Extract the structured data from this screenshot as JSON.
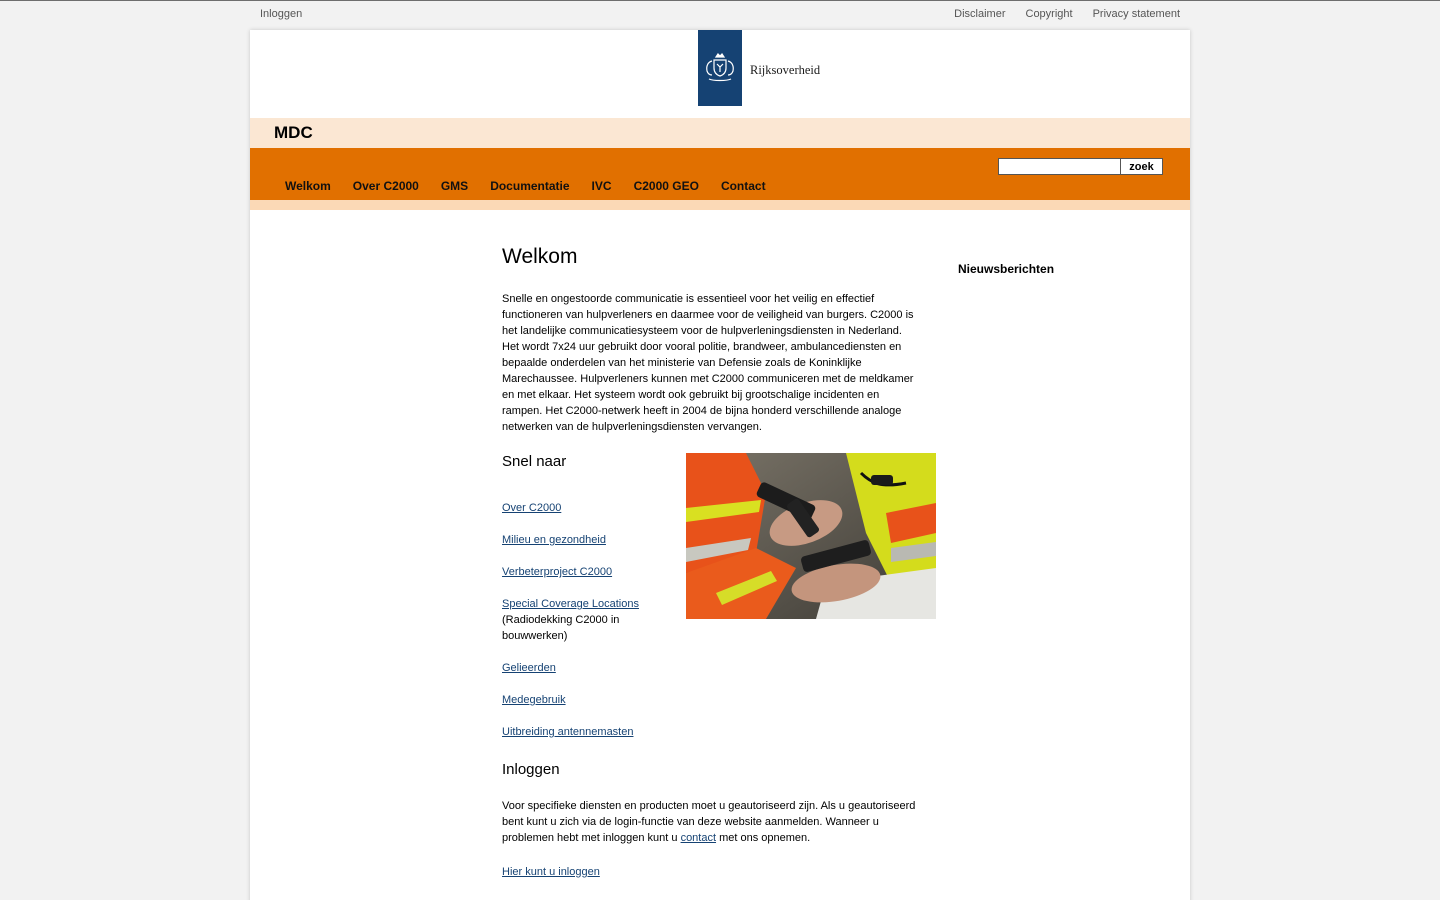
{
  "topbar": {
    "login": "Inloggen",
    "links": [
      "Disclaimer",
      "Copyright",
      "Privacy statement"
    ]
  },
  "logo": {
    "text": "Rijksoverheid"
  },
  "site": {
    "title": "MDC"
  },
  "search": {
    "button": "zoek",
    "value": ""
  },
  "nav": [
    "Welkom",
    "Over C2000",
    "GMS",
    "Documentatie",
    "IVC",
    "C2000 GEO",
    "Contact"
  ],
  "main": {
    "title": "Welkom",
    "intro": "Snelle en ongestoorde communicatie is essentieel voor het veilig en effectief functioneren van hulpverleners en daarmee voor de veiligheid van burgers. C2000 is het landelijke communicatiesysteem voor de hulpverleningsdiensten in Nederland. Het wordt 7x24 uur gebruikt door vooral politie, brandweer, ambulancediensten en bepaalde onderdelen van het ministerie van Defensie zoals de Koninklijke Marechaussee. Hulpverleners kunnen met C2000 communiceren met de meldkamer en met elkaar. Het systeem wordt ook gebruikt bij grootschalige incidenten en rampen. Het C2000-netwerk heeft in 2004 de bijna honderd verschillende analoge netwerken van de hulpverleningsdiensten vervangen.",
    "quick_title": "Snel naar",
    "quick_links": [
      {
        "label": "Over C2000",
        "note": ""
      },
      {
        "label": "Milieu en gezondheid",
        "note": ""
      },
      {
        "label": "Verbeterproject C2000",
        "note": ""
      },
      {
        "label": "Special Coverage Locations",
        "note": "(Radiodekking C2000 in bouwwerken)"
      },
      {
        "label": "Gelieerden",
        "note": ""
      },
      {
        "label": "Medegebruik",
        "note": ""
      },
      {
        "label": "Uitbreiding antennemasten",
        "note": ""
      }
    ],
    "login_title": "Inloggen",
    "login_text_before": "Voor specifieke diensten en producten moet u geautoriseerd zijn. Als u geautoriseerd bent kunt u zich via de login-functie van deze website aanmelden. Wanneer u problemen hebt met inloggen kunt u ",
    "login_text_link": "contact",
    "login_text_after": " met ons opnemen.",
    "login_link": "Hier kunt u inloggen"
  },
  "sidebar": {
    "title": "Nieuwsberichten"
  },
  "colors": {
    "accent_orange": "#e17000",
    "light_orange": "#fbe7d3",
    "logo_blue": "#154273"
  }
}
